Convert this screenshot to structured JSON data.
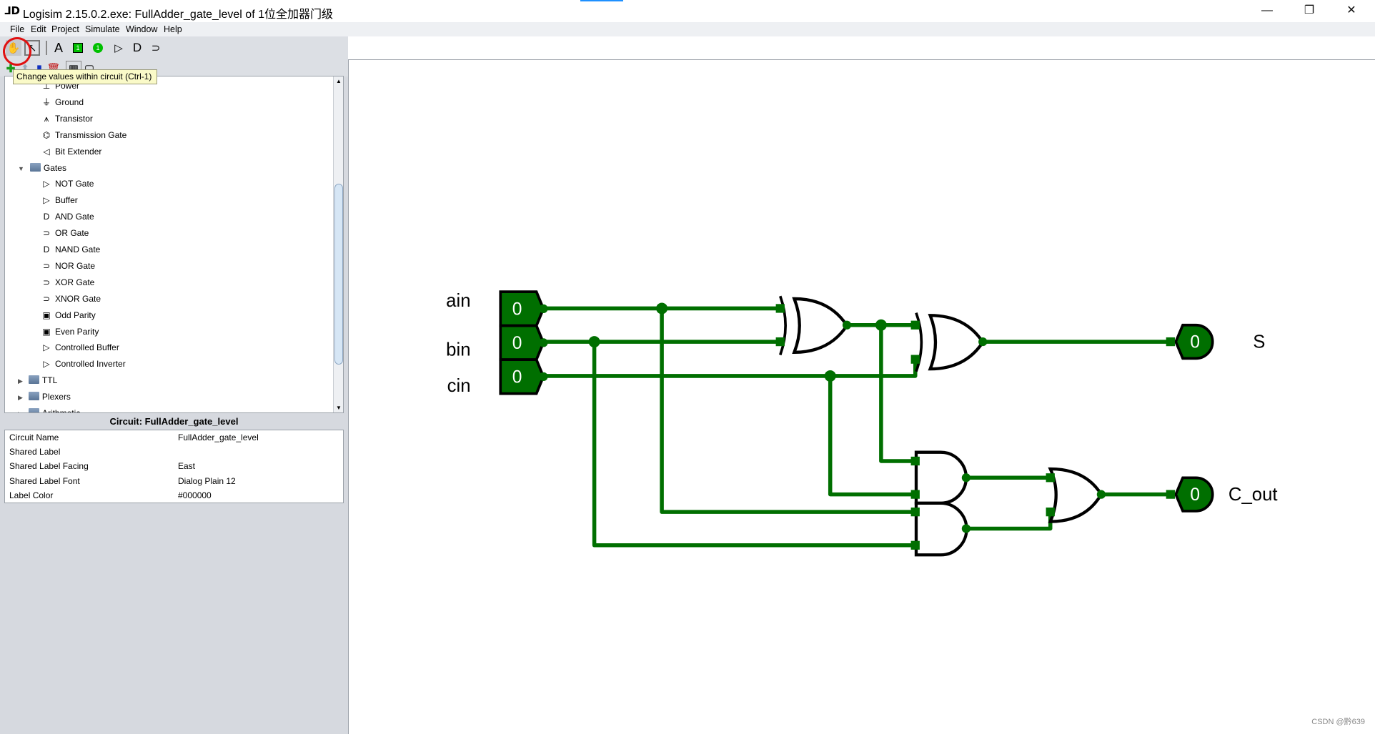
{
  "window": {
    "title": "Logisim 2.15.0.2.exe: FullAdder_gate_level of 1位全加器门级",
    "controls": [
      "minimize",
      "restore",
      "close"
    ]
  },
  "menu": [
    "File",
    "Edit",
    "Project",
    "Simulate",
    "Window",
    "Help"
  ],
  "toolbar": {
    "tools": [
      "hand-poke-icon",
      "select-arrow-icon",
      "text-icon",
      "input-pin-icon",
      "output-pin-icon",
      "not-gate-icon",
      "and-gate-icon",
      "or-gate-icon"
    ],
    "text_tool": "A",
    "pin_value": "1",
    "tooltip": "Change values within circuit (Ctrl-1)"
  },
  "tree": {
    "items": [
      {
        "label": "Power",
        "icon": "⊥",
        "type": "item"
      },
      {
        "label": "Ground",
        "icon": "⏚",
        "type": "item"
      },
      {
        "label": "Transistor",
        "icon": "⩚",
        "type": "item"
      },
      {
        "label": "Transmission Gate",
        "icon": "⌬",
        "type": "item"
      },
      {
        "label": "Bit Extender",
        "icon": "◁",
        "type": "item"
      },
      {
        "label": "Gates",
        "type": "folder",
        "expanded": true
      },
      {
        "label": "NOT Gate",
        "icon": "▷",
        "type": "item"
      },
      {
        "label": "Buffer",
        "icon": "▷",
        "type": "item"
      },
      {
        "label": "AND Gate",
        "icon": "D",
        "type": "item"
      },
      {
        "label": "OR Gate",
        "icon": "⊃",
        "type": "item"
      },
      {
        "label": "NAND Gate",
        "icon": "D",
        "type": "item"
      },
      {
        "label": "NOR Gate",
        "icon": "⊃",
        "type": "item"
      },
      {
        "label": "XOR Gate",
        "icon": "⊃",
        "type": "item"
      },
      {
        "label": "XNOR Gate",
        "icon": "⊃",
        "type": "item"
      },
      {
        "label": "Odd Parity",
        "icon": "▣",
        "type": "item"
      },
      {
        "label": "Even Parity",
        "icon": "▣",
        "type": "item"
      },
      {
        "label": "Controlled Buffer",
        "icon": "▷",
        "type": "item"
      },
      {
        "label": "Controlled Inverter",
        "icon": "▷",
        "type": "item"
      },
      {
        "label": "TTL",
        "type": "folder",
        "expanded": false
      },
      {
        "label": "Plexers",
        "type": "folder",
        "expanded": false
      },
      {
        "label": "Arithmetic",
        "type": "folder",
        "expanded": false
      }
    ]
  },
  "properties": {
    "header": "Circuit: FullAdder_gate_level",
    "rows": [
      {
        "name": "Circuit Name",
        "value": "FullAdder_gate_level"
      },
      {
        "name": "Shared Label",
        "value": ""
      },
      {
        "name": "Shared Label Facing",
        "value": "East"
      },
      {
        "name": "Shared Label Font",
        "value": "Dialog Plain 12"
      },
      {
        "name": "Label Color",
        "value": "#000000"
      }
    ]
  },
  "circuit": {
    "inputs": [
      {
        "label": "ain",
        "value": "0"
      },
      {
        "label": "bin",
        "value": "0"
      },
      {
        "label": "cin",
        "value": "0"
      }
    ],
    "outputs": [
      {
        "label": "S",
        "value": "0"
      },
      {
        "label": "C_out",
        "value": "0"
      }
    ],
    "wire_color": "#006f00"
  },
  "watermark": "CSDN @黔639"
}
